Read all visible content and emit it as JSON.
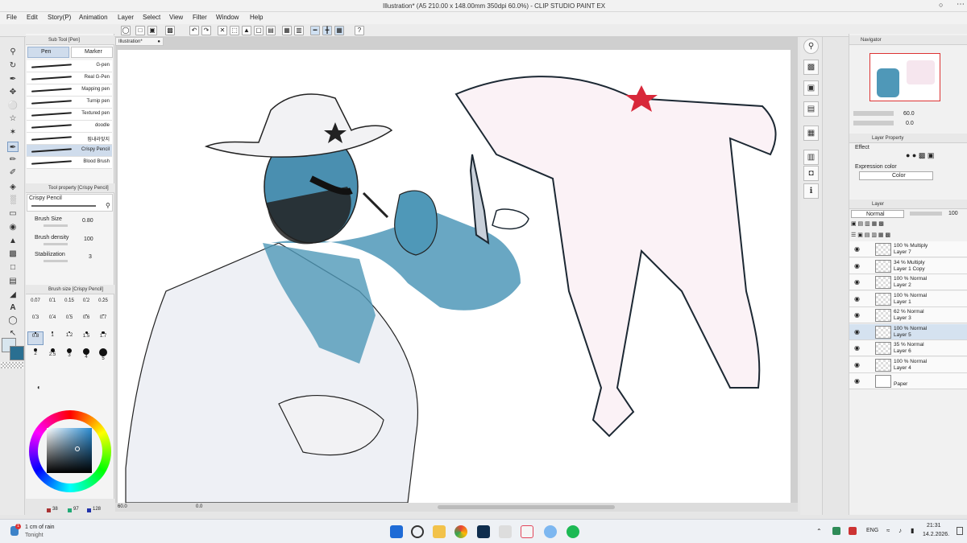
{
  "window": {
    "title": "Illustration* (A5 210.00 x 148.00mm 350dpi 60.0%) - CLIP STUDIO PAINT EX"
  },
  "menu": [
    "File",
    "Edit",
    "Story(P)",
    "Animation",
    "Layer",
    "Select",
    "View",
    "Filter",
    "Window",
    "Help"
  ],
  "canvas_tab": "Illustration*",
  "subtool": {
    "header": "Sub Tool [Pen]",
    "tabs": [
      "Pen",
      "Marker"
    ],
    "brushes": [
      "G-pen",
      "Real G-Pen",
      "Mapping pen",
      "Turnip pen",
      "Textured pen",
      "doodle",
      "핍내라맞지",
      "Crispy Pencil",
      "Blood Brush"
    ],
    "selected": "Crispy Pencil"
  },
  "tool_property": {
    "header": "Tool property [Crispy Pencil]",
    "name": "Crispy Pencil",
    "brush_size_label": "Brush Size",
    "brush_size_value": "0.80",
    "brush_density_label": "Brush density",
    "brush_density_value": "100",
    "stabilization_label": "Stabilization",
    "stabilization_value": "3"
  },
  "brush_size_panel": {
    "header": "Brush size [Crispy Pencil]",
    "sizes": [
      "0.07",
      "0.1",
      "0.15",
      "0.2",
      "0.25",
      "0.3",
      "0.4",
      "0.5",
      "0.6",
      "0.7",
      "0.8",
      "1",
      "1.2",
      "1.5",
      "1.7",
      "2",
      "2.5",
      "3",
      "4",
      "5"
    ],
    "selected": "0.8"
  },
  "color": {
    "main": "#d8e6ef",
    "sub": "#2a6f91",
    "r": "38",
    "g": "97",
    "b": "128"
  },
  "status": {
    "zoom": "60.0",
    "angle": "0.0"
  },
  "navigator": {
    "header": "Navigator",
    "zoom": "60.0",
    "angle": "0.0"
  },
  "layer_property": {
    "header": "Layer Property",
    "effect_label": "Effect",
    "expression_label": "Expression color",
    "expression_value": "Color"
  },
  "layers_panel": {
    "header": "Layer",
    "blend_mode": "Normal",
    "opacity": "100",
    "layers": [
      {
        "l1": "100 % Multiply",
        "l2": "Layer 7"
      },
      {
        "l1": "34 % Multiply",
        "l2": "Layer 1 Copy"
      },
      {
        "l1": "100 % Normal",
        "l2": "Layer 2"
      },
      {
        "l1": "100 % Normal",
        "l2": "Layer 1"
      },
      {
        "l1": "62 % Normal",
        "l2": "Layer 3"
      },
      {
        "l1": "100 % Normal",
        "l2": "Layer 5"
      },
      {
        "l1": "35 % Normal",
        "l2": "Layer 6"
      },
      {
        "l1": "100 % Normal",
        "l2": "Layer 4"
      },
      {
        "l1": "",
        "l2": "Paper"
      }
    ],
    "selected_layer": "Layer 5"
  },
  "taskbar": {
    "weather_value": "1 cm of rain",
    "weather_sub": "Tonight",
    "badge": "1",
    "lang": "ENG",
    "time": "21:31",
    "date": "14.2.2026."
  }
}
